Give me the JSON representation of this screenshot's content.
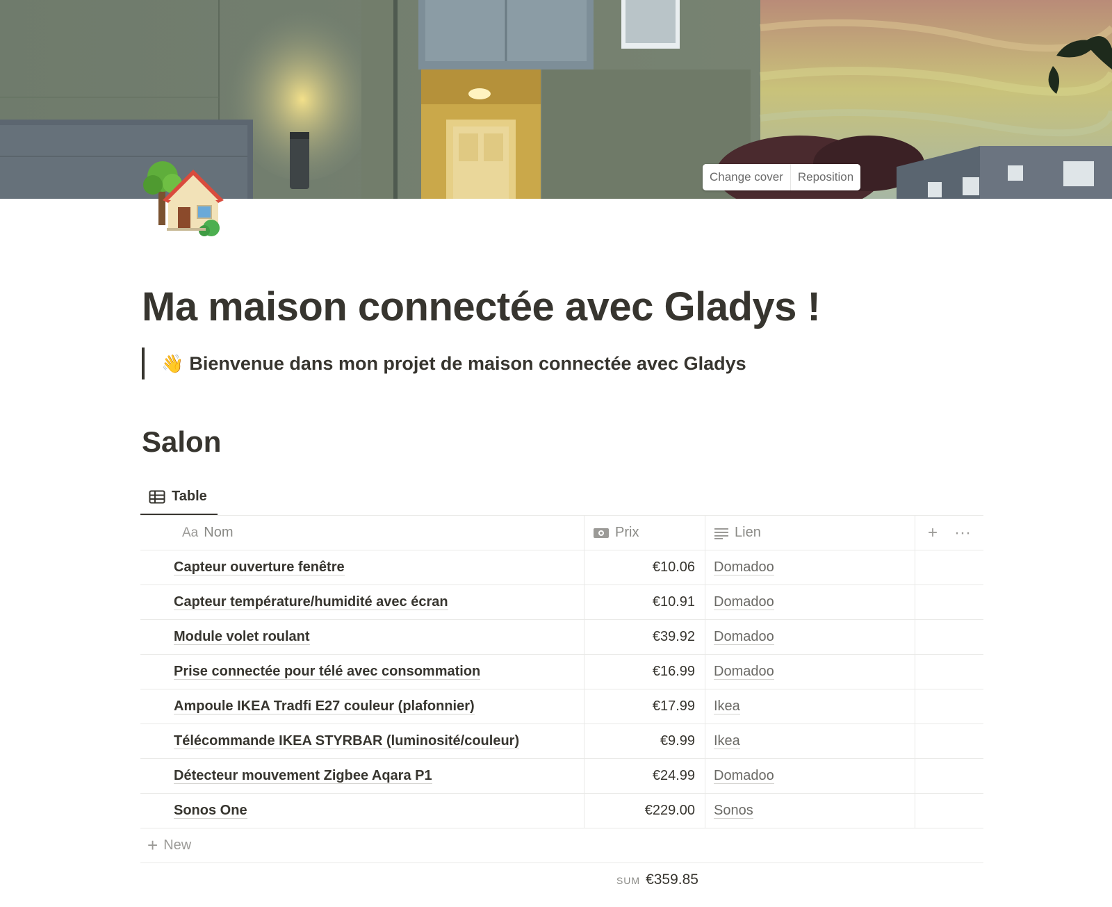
{
  "cover": {
    "change_cover_label": "Change cover",
    "reposition_label": "Reposition"
  },
  "page": {
    "icon": "house-with-garden-icon",
    "title": "Ma maison connectée avec Gladys !",
    "quote_emoji": "👋",
    "quote_text": "Bienvenue dans mon projet de maison connectée avec Gladys"
  },
  "section": {
    "title": "Salon",
    "view_tab_label": "Table"
  },
  "table": {
    "columns": {
      "name": {
        "icon_text": "Aa",
        "label": "Nom"
      },
      "price": {
        "icon": "money-icon",
        "label": "Prix"
      },
      "link": {
        "icon": "text-lines-icon",
        "label": "Lien"
      },
      "add": "+",
      "more": "···"
    },
    "rows": [
      {
        "name": "Capteur ouverture fenêtre",
        "price": "€10.06",
        "link": "Domadoo"
      },
      {
        "name": "Capteur température/humidité avec écran",
        "price": "€10.91",
        "link": "Domadoo"
      },
      {
        "name": "Module volet roulant",
        "price": "€39.92",
        "link": "Domadoo"
      },
      {
        "name": "Prise connectée pour télé avec consommation",
        "price": "€16.99",
        "link": "Domadoo"
      },
      {
        "name": "Ampoule IKEA Tradfi E27 couleur (plafonnier)",
        "price": "€17.99",
        "link": "Ikea"
      },
      {
        "name": "Télécommande IKEA STYRBAR (luminosité/couleur)",
        "price": "€9.99",
        "link": "Ikea"
      },
      {
        "name": "Détecteur mouvement Zigbee Aqara P1",
        "price": "€24.99",
        "link": "Domadoo"
      },
      {
        "name": "Sonos One",
        "price": "€229.00",
        "link": "Sonos"
      }
    ],
    "new_label": "New",
    "sum_label": "SUM",
    "sum_value": "€359.85"
  }
}
